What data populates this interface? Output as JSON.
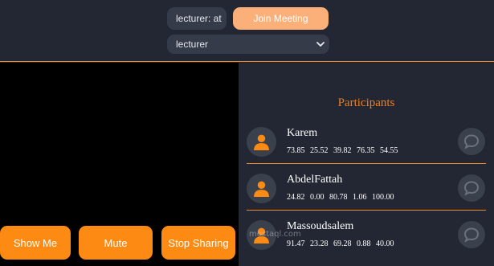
{
  "header": {
    "name_input_value": "lecturer: at",
    "join_button_label": "Join Meeting",
    "role_select_value": "lecturer"
  },
  "controls": {
    "show_me_label": "Show Me",
    "mute_label": "Mute",
    "stop_sharing_label": "Stop Sharing"
  },
  "participants_panel": {
    "title": "Participants",
    "participants": [
      {
        "name": "Karem",
        "stats": "73.85 25.52 39.82 76.35 54.55"
      },
      {
        "name": "AbdelFattah",
        "stats": "24.82 0.00 80.78 1.06 100.00"
      },
      {
        "name": "Massoudsalem",
        "stats": "91.47 23.28 69.28 0.88 40.00"
      }
    ]
  },
  "watermark": {
    "text": "mostaql.com"
  },
  "colors": {
    "accent": "#fd8a12",
    "join_button": "#fbb079",
    "background": "#232733",
    "title": "#f07f18"
  },
  "icons": [
    "chevron-down-icon",
    "user-icon",
    "chat-bubble-icon"
  ]
}
